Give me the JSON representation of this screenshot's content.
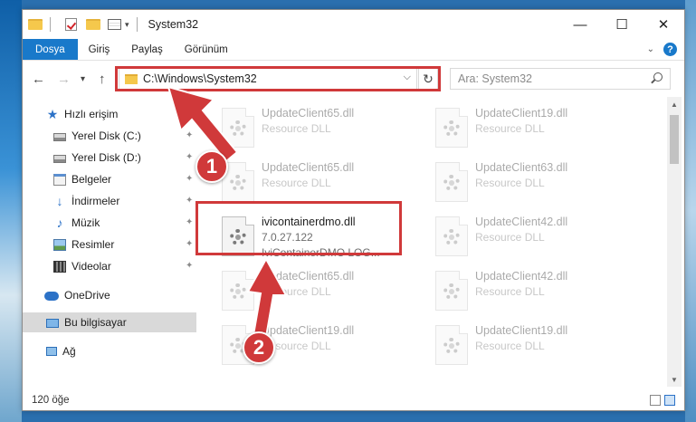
{
  "window": {
    "title": "System32",
    "controls": {
      "minimize": "—",
      "maximize": "☐",
      "close": "✕"
    }
  },
  "ribbon": {
    "tabs": [
      "Dosya",
      "Giriş",
      "Paylaş",
      "Görünüm"
    ],
    "help": "?"
  },
  "address": {
    "path": "C:\\Windows\\System32",
    "search_placeholder": "Ara: System32"
  },
  "sidebar": {
    "items": [
      {
        "label": "Hızlı erişim",
        "icon": "star-icon"
      },
      {
        "label": "Yerel Disk (C:)",
        "icon": "drive-icon",
        "pinned": true
      },
      {
        "label": "Yerel Disk (D:)",
        "icon": "drive-icon",
        "pinned": true
      },
      {
        "label": "Belgeler",
        "icon": "documents-icon",
        "pinned": true
      },
      {
        "label": "İndirmeler",
        "icon": "download-icon",
        "pinned": true
      },
      {
        "label": "Müzik",
        "icon": "music-icon",
        "pinned": true
      },
      {
        "label": "Resimler",
        "icon": "pictures-icon",
        "pinned": true
      },
      {
        "label": "Videolar",
        "icon": "videos-icon",
        "pinned": true
      },
      {
        "label": "OneDrive",
        "icon": "onedrive-icon"
      },
      {
        "label": "Bu bilgisayar",
        "icon": "computer-icon",
        "selected": true
      },
      {
        "label": "Ağ",
        "icon": "network-icon"
      }
    ]
  },
  "files": [
    {
      "name": "UpdateClient65.dll",
      "type": "Resource DLL"
    },
    {
      "name": "UpdateClient19.dll",
      "type": "Resource DLL"
    },
    {
      "name": "UpdateClient65.dll",
      "type": "Resource DLL"
    },
    {
      "name": "UpdateClient63.dll",
      "type": "Resource DLL"
    },
    {
      "name": "ivicontainerdmo.dll",
      "version": "7.0.27.122",
      "description": "IviContainerDMO LOG...",
      "highlighted": true
    },
    {
      "name": "UpdateClient42.dll",
      "type": "Resource DLL"
    },
    {
      "name": "UpdateClient65.dll",
      "type": "Resource DLL"
    },
    {
      "name": "UpdateClient42.dll",
      "type": "Resource DLL"
    },
    {
      "name": "UpdateClient19.dll",
      "type": "Resource DLL"
    },
    {
      "name": "UpdateClient19.dll",
      "type": "Resource DLL"
    }
  ],
  "status": {
    "item_count": "120 öğe"
  },
  "annotations": {
    "step1": "1",
    "step2": "2",
    "color": "#d0393a"
  }
}
